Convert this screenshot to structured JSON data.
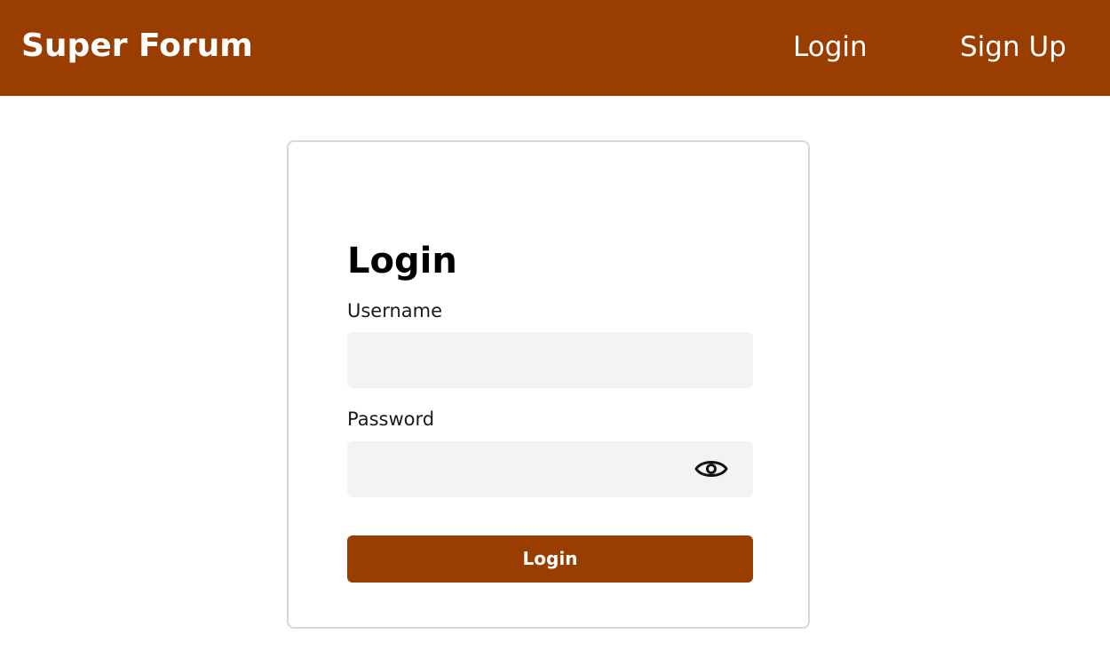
{
  "navbar": {
    "brand": "Super Forum",
    "links": [
      {
        "label": "Login"
      },
      {
        "label": "Sign Up"
      }
    ],
    "background_color": "#993d00"
  },
  "login_form": {
    "title": "Login",
    "username": {
      "label": "Username",
      "value": "",
      "placeholder": ""
    },
    "password": {
      "label": "Password",
      "value": "",
      "placeholder": "",
      "toggle_icon": "eye-icon"
    },
    "submit_label": "Login",
    "button_color": "#993d00"
  }
}
